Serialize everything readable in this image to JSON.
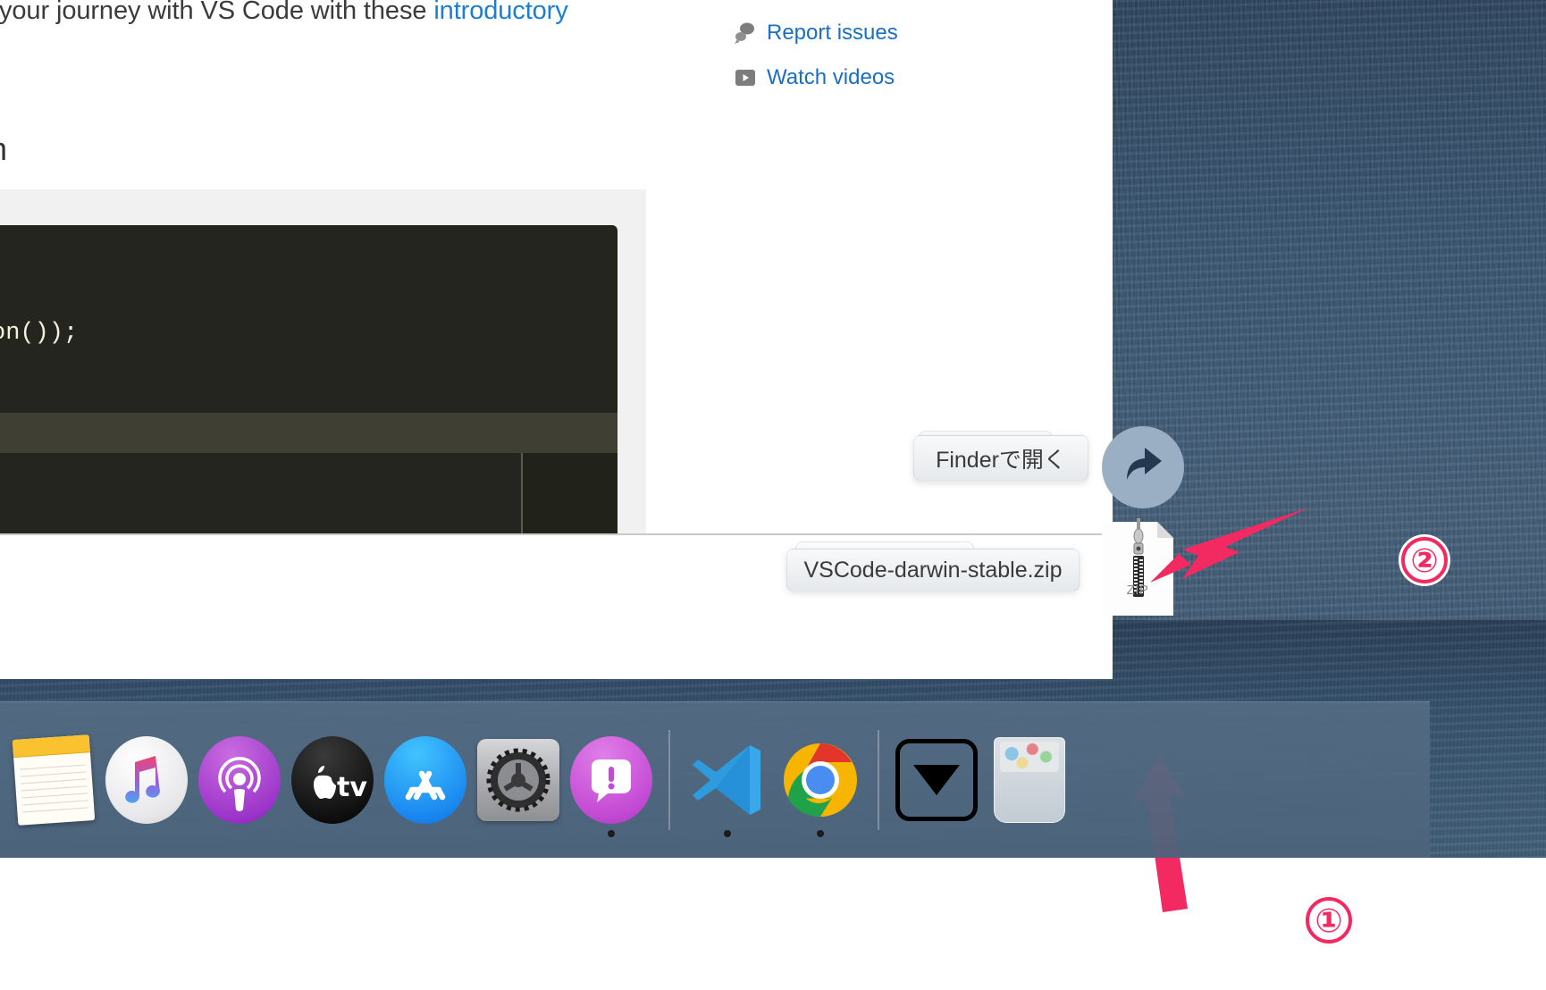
{
  "welcome": {
    "headline": "your journey with VS Code with these ",
    "headline_link": "introductory",
    "heading_fragment": "n",
    "help_links": [
      {
        "label": "Report issues",
        "icon": "speech-bubbles-icon"
      },
      {
        "label": "Watch videos",
        "icon": "play-button-icon"
      }
    ],
    "editor_code": "on());"
  },
  "tooltips": {
    "open_in_finder": "Finderで開く",
    "downloaded_file": "VSCode-darwin-stable.zip"
  },
  "file": {
    "type_label": "ZIP",
    "icon": "zip-file-icon"
  },
  "share_button": {
    "icon": "share-arrow-icon"
  },
  "annotations": {
    "marker_one": "①",
    "marker_two": "②",
    "arrow_color": "#f32a62"
  },
  "dock": {
    "items": [
      {
        "name": "notes",
        "label": "Notes",
        "running": false
      },
      {
        "name": "music",
        "label": "Music",
        "running": false
      },
      {
        "name": "podcasts",
        "label": "Podcasts",
        "running": false
      },
      {
        "name": "tv",
        "label": "TV",
        "running": false
      },
      {
        "name": "app-store",
        "label": "App Store",
        "running": false
      },
      {
        "name": "system-preferences",
        "label": "System Preferences",
        "running": false
      },
      {
        "name": "messages",
        "label": "Messages",
        "running": true
      },
      {
        "name": "vscode",
        "label": "Visual Studio Code",
        "running": true
      },
      {
        "name": "chrome",
        "label": "Google Chrome",
        "running": true
      },
      {
        "name": "downloads",
        "label": "Downloads",
        "running": false
      },
      {
        "name": "trash",
        "label": "Trash",
        "running": false
      }
    ],
    "tv_label": "tv"
  },
  "colors": {
    "accent_link": "#1a6fc4",
    "annotation_pink": "#f32a62",
    "dock_bg": "#546c83",
    "desktop_blue": "#3a5773",
    "editor_bg": "#24251f",
    "editor_highlight": "#3f4033"
  }
}
